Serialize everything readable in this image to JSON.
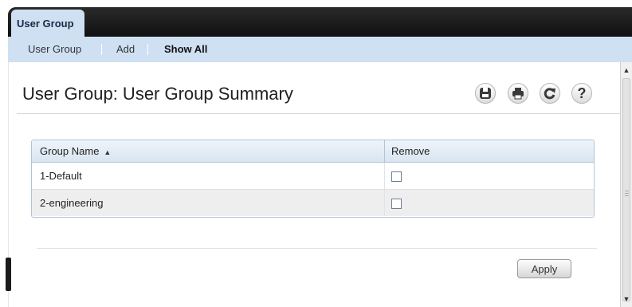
{
  "tabs": {
    "main": "User Group"
  },
  "subnav": {
    "items": [
      {
        "label": "User Group",
        "active": false
      },
      {
        "label": "Add",
        "active": false
      },
      {
        "label": "Show All",
        "active": true
      }
    ]
  },
  "page": {
    "title": "User Group: User Group Summary"
  },
  "toolbar": {
    "icons": [
      "save-icon",
      "print-icon",
      "refresh-icon",
      "help-icon"
    ],
    "help_glyph": "?"
  },
  "table": {
    "columns": [
      "Group Name",
      "Remove"
    ],
    "sort_indicator": "▲",
    "rows": [
      {
        "name": "1-Default",
        "remove": false
      },
      {
        "name": "2-engineering",
        "remove": false
      }
    ]
  },
  "actions": {
    "apply_label": "Apply"
  },
  "colors": {
    "tab_bar": "#1f1f1f",
    "subnav_bg": "#cfe0f3",
    "table_header": "#d9e5f1",
    "row_alt": "#eeeeee"
  }
}
